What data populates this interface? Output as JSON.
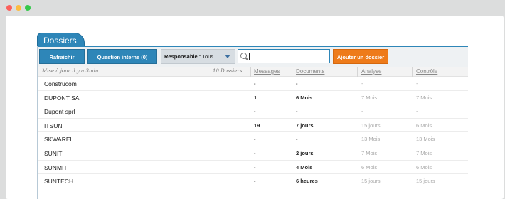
{
  "panel": {
    "tab_label": "Dossiers"
  },
  "toolbar": {
    "refresh_label": "Rafraichir",
    "question_label": "Question interne (0)",
    "responsable_label": "Responsable :",
    "responsable_value": "Tous",
    "search_value": "",
    "add_label": "Ajouter un dossier"
  },
  "table": {
    "updated_text": "Mise à jour il y a 3min",
    "count_text": "10 Dossiers",
    "columns": {
      "messages": "Messages",
      "documents": "Documents",
      "analyse": "Analyse",
      "controle": "Contrôle"
    },
    "rows": [
      {
        "name": "Construcom",
        "messages": "-",
        "documents": "-",
        "analyse": "-",
        "controle": "-"
      },
      {
        "name": "DUPONT SA",
        "messages": "1",
        "documents": "6 Mois",
        "analyse": "7 Mois",
        "controle": "7 Mois"
      },
      {
        "name": "Dupont sprl",
        "messages": "-",
        "documents": "-",
        "analyse": "-",
        "controle": "-"
      },
      {
        "name": "ITSUN",
        "messages": "19",
        "documents": "7 jours",
        "analyse": "15 jours",
        "controle": "6 Mois"
      },
      {
        "name": "SKWAREL",
        "messages": "-",
        "documents": "-",
        "analyse": "13 Mois",
        "controle": "13 Mois"
      },
      {
        "name": "SUNIT",
        "messages": "-",
        "documents": "2 jours",
        "analyse": "7 Mois",
        "controle": "7 Mois"
      },
      {
        "name": "SUNMIT",
        "messages": "-",
        "documents": "4 Mois",
        "analyse": "6 Mois",
        "controle": "6 Mois"
      },
      {
        "name": "SUNTECH",
        "messages": "-",
        "documents": "6 heures",
        "analyse": "15 jours",
        "controle": "15 jours"
      }
    ]
  }
}
